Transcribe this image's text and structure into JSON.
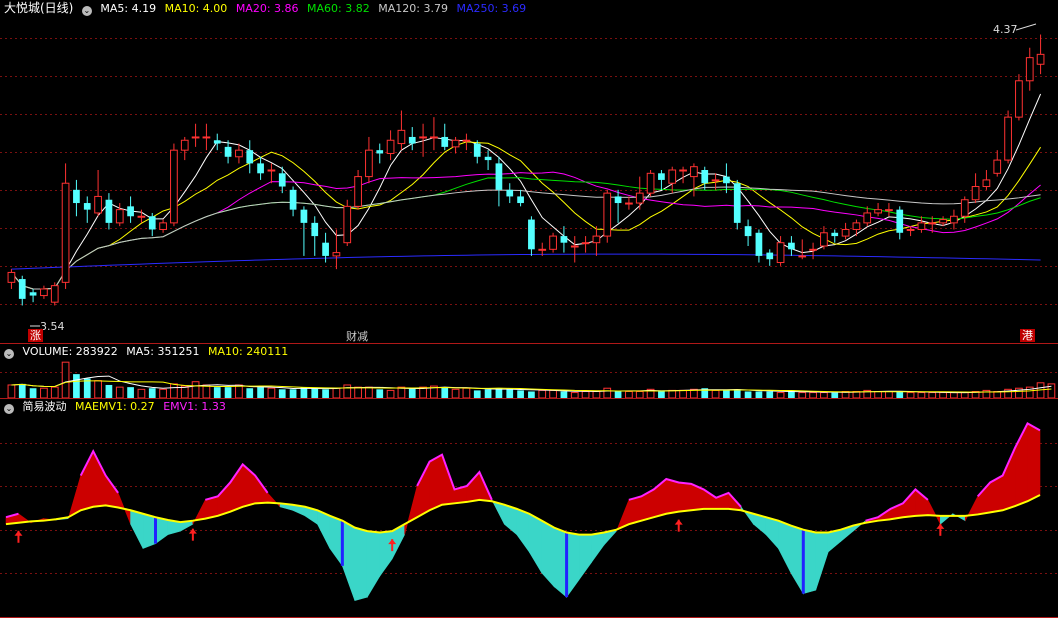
{
  "colors": {
    "up": "#ff3232",
    "down": "#54ffff",
    "bg": "#000000",
    "grid": "#7a1010",
    "ma5": "#ffffff",
    "ma10": "#ffff00",
    "ma20": "#ff00ff",
    "ma60": "#00e000",
    "ma120": "#c8c8c8",
    "ma250": "#2b2bff",
    "fill_pos": "#cc0000",
    "fill_neg": "#3ad6c8",
    "emv_line": "#ff22ff",
    "maemv_line": "#ffff00",
    "arrow": "#ff2020",
    "bar_blue": "#2222ff"
  },
  "main_header": {
    "title": "大悦城(日线)",
    "ma5": "MA5: 4.19",
    "ma10": "MA10: 4.00",
    "ma20": "MA20: 3.86",
    "ma60": "MA60: 3.82",
    "ma120": "MA120: 3.79",
    "ma250": "MA250: 3.69"
  },
  "main_labels": {
    "high_label": "4.37",
    "low_label": "3.54",
    "tag_left": "涨",
    "tag_mid": "财减",
    "tag_right": "港"
  },
  "vol_header": {
    "volume": "VOLUME: 283922",
    "ma5": "MA5: 351251",
    "ma10": "MA10: 240111"
  },
  "ind_header": {
    "name": "简易波动",
    "maemv": "MAEMV1: 0.27",
    "emv": "EMV1: 1.33"
  },
  "chart_data": [
    {
      "type": "candlestick",
      "title": "大悦城(日线)",
      "ylim": [
        3.5,
        4.42
      ],
      "price_labels": {
        "high": 4.37,
        "low": 3.54
      },
      "series": [
        {
          "name": "MA5",
          "value": 4.19
        },
        {
          "name": "MA10",
          "value": 4.0
        },
        {
          "name": "MA20",
          "value": 3.86
        },
        {
          "name": "MA60",
          "value": 3.82
        },
        {
          "name": "MA120",
          "value": 3.79
        },
        {
          "name": "MA250",
          "value": 3.69
        }
      ],
      "candles": [
        [
          3.62,
          3.65,
          3.6,
          3.66
        ],
        [
          3.63,
          3.57,
          3.55,
          3.64
        ],
        [
          3.59,
          3.58,
          3.56,
          3.6
        ],
        [
          3.58,
          3.6,
          3.57,
          3.61
        ],
        [
          3.56,
          3.61,
          3.55,
          3.62
        ],
        [
          3.62,
          3.92,
          3.6,
          3.98
        ],
        [
          3.9,
          3.86,
          3.82,
          3.93
        ],
        [
          3.86,
          3.84,
          3.8,
          3.88
        ],
        [
          3.83,
          3.88,
          3.82,
          3.96
        ],
        [
          3.87,
          3.8,
          3.78,
          3.89
        ],
        [
          3.8,
          3.84,
          3.79,
          3.86
        ],
        [
          3.85,
          3.82,
          3.8,
          3.88
        ],
        [
          3.82,
          3.82,
          3.8,
          3.84
        ],
        [
          3.82,
          3.78,
          3.76,
          3.83
        ],
        [
          3.78,
          3.8,
          3.77,
          3.81
        ],
        [
          3.8,
          4.02,
          3.79,
          4.04
        ],
        [
          4.02,
          4.05,
          3.99,
          4.06
        ],
        [
          4.06,
          4.06,
          4.03,
          4.1
        ],
        [
          4.06,
          4.06,
          4.02,
          4.1
        ],
        [
          4.05,
          4.04,
          4.02,
          4.07
        ],
        [
          4.03,
          4.0,
          3.98,
          4.05
        ],
        [
          4.0,
          4.02,
          3.98,
          4.04
        ],
        [
          4.02,
          3.98,
          3.95,
          4.05
        ],
        [
          3.98,
          3.95,
          3.93,
          4.0
        ],
        [
          3.96,
          3.96,
          3.92,
          3.98
        ],
        [
          3.95,
          3.91,
          3.89,
          3.97
        ],
        [
          3.9,
          3.84,
          3.82,
          3.91
        ],
        [
          3.84,
          3.8,
          3.7,
          3.85
        ],
        [
          3.8,
          3.76,
          3.7,
          3.82
        ],
        [
          3.74,
          3.7,
          3.68,
          3.77
        ],
        [
          3.7,
          3.71,
          3.66,
          3.78
        ],
        [
          3.74,
          3.85,
          3.73,
          3.87
        ],
        [
          3.85,
          3.94,
          3.84,
          3.96
        ],
        [
          3.94,
          4.02,
          3.92,
          4.06
        ],
        [
          4.02,
          4.01,
          3.98,
          4.04
        ],
        [
          4.01,
          4.05,
          3.99,
          4.08
        ],
        [
          4.04,
          4.08,
          4.02,
          4.14
        ],
        [
          4.06,
          4.04,
          4.02,
          4.09
        ],
        [
          4.06,
          4.06,
          4.0,
          4.1
        ],
        [
          4.06,
          4.06,
          4.02,
          4.12
        ],
        [
          4.06,
          4.03,
          4.02,
          4.1
        ],
        [
          4.03,
          4.05,
          4.01,
          4.06
        ],
        [
          4.05,
          4.05,
          4.02,
          4.07
        ],
        [
          4.04,
          4.0,
          3.98,
          4.05
        ],
        [
          4.0,
          3.99,
          3.96,
          4.02
        ],
        [
          3.98,
          3.9,
          3.85,
          4.0
        ],
        [
          3.9,
          3.88,
          3.86,
          3.92
        ],
        [
          3.88,
          3.86,
          3.85,
          3.9
        ],
        [
          3.81,
          3.72,
          3.7,
          3.82
        ],
        [
          3.72,
          3.72,
          3.7,
          3.74
        ],
        [
          3.72,
          3.76,
          3.71,
          3.77
        ],
        [
          3.76,
          3.74,
          3.71,
          3.79
        ],
        [
          3.73,
          3.73,
          3.68,
          3.76
        ],
        [
          3.74,
          3.74,
          3.71,
          3.76
        ],
        [
          3.74,
          3.76,
          3.7,
          3.79
        ],
        [
          3.76,
          3.89,
          3.74,
          3.9
        ],
        [
          3.88,
          3.86,
          3.8,
          3.9
        ],
        [
          3.86,
          3.86,
          3.84,
          3.88
        ],
        [
          3.86,
          3.89,
          3.84,
          3.94
        ],
        [
          3.89,
          3.95,
          3.88,
          3.96
        ],
        [
          3.95,
          3.93,
          3.9,
          3.96
        ],
        [
          3.92,
          3.96,
          3.89,
          3.97
        ],
        [
          3.96,
          3.96,
          3.92,
          3.97
        ],
        [
          3.94,
          3.97,
          3.88,
          3.98
        ],
        [
          3.96,
          3.92,
          3.9,
          3.97
        ],
        [
          3.93,
          3.93,
          3.9,
          3.95
        ],
        [
          3.94,
          3.92,
          3.89,
          3.98
        ],
        [
          3.92,
          3.8,
          3.78,
          3.93
        ],
        [
          3.79,
          3.76,
          3.73,
          3.81
        ],
        [
          3.77,
          3.7,
          3.68,
          3.78
        ],
        [
          3.71,
          3.69,
          3.67,
          3.72
        ],
        [
          3.68,
          3.74,
          3.67,
          3.76
        ],
        [
          3.74,
          3.72,
          3.7,
          3.76
        ],
        [
          3.7,
          3.7,
          3.69,
          3.75
        ],
        [
          3.72,
          3.72,
          3.69,
          3.74
        ],
        [
          3.73,
          3.77,
          3.72,
          3.79
        ],
        [
          3.77,
          3.76,
          3.74,
          3.78
        ],
        [
          3.76,
          3.78,
          3.75,
          3.8
        ],
        [
          3.78,
          3.8,
          3.76,
          3.81
        ],
        [
          3.8,
          3.83,
          3.79,
          3.85
        ],
        [
          3.83,
          3.84,
          3.82,
          3.86
        ],
        [
          3.84,
          3.84,
          3.82,
          3.86
        ],
        [
          3.84,
          3.77,
          3.75,
          3.85
        ],
        [
          3.78,
          3.78,
          3.76,
          3.79
        ],
        [
          3.78,
          3.8,
          3.77,
          3.82
        ],
        [
          3.8,
          3.8,
          3.77,
          3.82
        ],
        [
          3.8,
          3.81,
          3.79,
          3.82
        ],
        [
          3.8,
          3.82,
          3.78,
          3.84
        ],
        [
          3.82,
          3.87,
          3.8,
          3.88
        ],
        [
          3.87,
          3.91,
          3.86,
          3.95
        ],
        [
          3.91,
          3.93,
          3.9,
          3.96
        ],
        [
          3.95,
          3.99,
          3.94,
          4.02
        ],
        [
          3.99,
          4.12,
          3.98,
          4.14
        ],
        [
          4.12,
          4.23,
          4.11,
          4.25
        ],
        [
          4.23,
          4.3,
          4.2,
          4.33
        ],
        [
          4.28,
          4.31,
          4.25,
          4.37
        ]
      ]
    },
    {
      "type": "bar",
      "title": "VOLUME",
      "series": [
        {
          "name": "VOLUME",
          "value": 283922
        },
        {
          "name": "MA5",
          "value": 351251
        },
        {
          "name": "MA10",
          "value": 240111
        }
      ],
      "values": [
        12,
        13,
        9,
        9,
        10,
        33,
        22,
        18,
        16,
        12,
        10,
        10,
        8,
        9,
        8,
        13,
        11,
        15,
        12,
        10,
        10,
        12,
        9,
        10,
        9,
        8,
        8,
        10,
        9,
        8,
        9,
        12,
        10,
        10,
        8,
        7,
        10,
        9,
        10,
        11,
        10,
        8,
        9,
        7,
        8,
        9,
        8,
        7,
        6,
        7,
        7,
        6,
        5,
        6,
        6,
        9,
        6,
        6,
        6,
        8,
        7,
        7,
        7,
        8,
        9,
        7,
        7,
        8,
        6,
        6,
        6,
        5,
        7,
        5,
        5,
        5,
        5,
        6,
        6,
        7,
        6,
        6,
        6,
        5,
        5,
        5,
        5,
        5,
        5,
        6,
        7,
        6,
        8,
        9,
        10,
        14,
        13
      ]
    },
    {
      "type": "area",
      "title": "简易波动",
      "series": [
        {
          "name": "MAEMV1",
          "value": 0.27
        },
        {
          "name": "EMV1",
          "value": 1.33
        }
      ],
      "emv": [
        0.1,
        0.15,
        0.02,
        0.08,
        0.06,
        0.08,
        0.7,
        1.05,
        0.7,
        0.45,
        0.0,
        -0.35,
        -0.28,
        -0.15,
        -0.1,
        0.0,
        0.35,
        0.4,
        0.6,
        0.86,
        0.7,
        0.45,
        0.25,
        0.2,
        0.12,
        0.0,
        -0.35,
        -0.6,
        -1.1,
        -1.05,
        -0.75,
        -0.5,
        -0.15,
        0.55,
        0.9,
        1.0,
        0.5,
        0.55,
        0.75,
        0.35,
        0.0,
        -0.15,
        -0.4,
        -0.7,
        -0.9,
        -1.05,
        -0.8,
        -0.55,
        -0.3,
        -0.1,
        0.35,
        0.4,
        0.5,
        0.65,
        0.6,
        0.58,
        0.5,
        0.38,
        0.45,
        0.25,
        0.0,
        -0.15,
        -0.35,
        -0.7,
        -1.0,
        -0.95,
        -0.4,
        -0.25,
        -0.1,
        0.05,
        0.1,
        0.22,
        0.3,
        0.5,
        0.35,
        0.0,
        0.15,
        0.05,
        0.4,
        0.6,
        0.7,
        1.1,
        1.45,
        1.35
      ],
      "maemv": [
        0.0,
        0.02,
        0.04,
        0.05,
        0.07,
        0.1,
        0.2,
        0.25,
        0.27,
        0.24,
        0.2,
        0.15,
        0.1,
        0.06,
        0.03,
        0.05,
        0.08,
        0.12,
        0.18,
        0.25,
        0.3,
        0.31,
        0.3,
        0.28,
        0.25,
        0.2,
        0.12,
        0.05,
        -0.05,
        -0.1,
        -0.12,
        -0.1,
        0.0,
        0.1,
        0.2,
        0.28,
        0.3,
        0.32,
        0.35,
        0.33,
        0.28,
        0.22,
        0.15,
        0.05,
        -0.05,
        -0.12,
        -0.15,
        -0.15,
        -0.12,
        -0.08,
        0.0,
        0.05,
        0.1,
        0.15,
        0.18,
        0.2,
        0.22,
        0.22,
        0.22,
        0.2,
        0.15,
        0.1,
        0.05,
        -0.02,
        -0.08,
        -0.12,
        -0.12,
        -0.08,
        -0.02,
        0.02,
        0.05,
        0.07,
        0.1,
        0.12,
        0.13,
        0.12,
        0.12,
        0.12,
        0.14,
        0.17,
        0.2,
        0.26,
        0.33,
        0.42
      ],
      "ylim": [
        -1.25,
        1.6
      ],
      "up_arrows_at": [
        1,
        15,
        31,
        54,
        75,
        84,
        88
      ]
    }
  ]
}
